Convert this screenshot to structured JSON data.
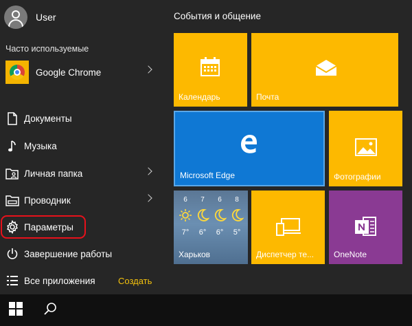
{
  "user": {
    "name": "User"
  },
  "frequent": {
    "title": "Часто используемые",
    "items": [
      {
        "label": "Google Chrome",
        "icon": "chrome-icon"
      }
    ]
  },
  "places": [
    {
      "label": "Документы",
      "icon": "document-icon"
    },
    {
      "label": "Музыка",
      "icon": "music-note-icon"
    },
    {
      "label": "Личная папка",
      "icon": "personal-folder-icon"
    },
    {
      "label": "Проводник",
      "icon": "file-explorer-icon"
    },
    {
      "label": "Параметры",
      "icon": "gear-icon"
    },
    {
      "label": "Завершение работы",
      "icon": "power-icon"
    },
    {
      "label": "Все приложения",
      "icon": "all-apps-icon"
    }
  ],
  "create_label": "Создать",
  "tiles": {
    "group_title": "События и общение",
    "calendar": "Календарь",
    "mail": "Почта",
    "edge": "Microsoft Edge",
    "photos": "Фотографии",
    "weather": {
      "city": "Харьков",
      "days": [
        {
          "day": "6",
          "temp": "7°",
          "icon": "sun-icon"
        },
        {
          "day": "7",
          "temp": "6°",
          "icon": "moon-icon"
        },
        {
          "day": "6",
          "temp": "6°",
          "icon": "moon-icon"
        },
        {
          "day": "8",
          "temp": "5°",
          "icon": "moon-icon"
        }
      ]
    },
    "phone_companion": "Диспетчер те...",
    "onenote": "OneNote"
  },
  "colors": {
    "tile_yellow": "#fdb900",
    "tile_blue": "#0f78d4",
    "tile_purple": "#8a3a93",
    "highlight_ring": "#e8111b",
    "accent_text": "#f4c20d"
  }
}
